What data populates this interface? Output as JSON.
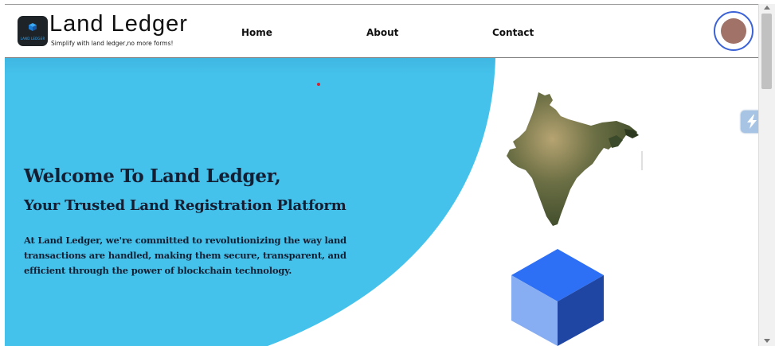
{
  "brand": {
    "title": "Land Ledger",
    "subtitle": "Simplify with land ledger,no more forms!",
    "logo_text": "LAND LEDGER"
  },
  "nav": {
    "home": "Home",
    "about": "About",
    "contact": "Contact"
  },
  "hero": {
    "welcome": "Welcome To Land Ledger,",
    "tagline": "Your Trusted Land Registration Platform",
    "description": "At Land Ledger, we're committed to revolutionizing the way land transactions are handled, making them secure, transparent, and efficient through the power of blockchain technology."
  },
  "colors": {
    "hero_blue": "#44c2eb",
    "avatar_ring": "#3b62d6",
    "avatar_fill": "#a07268",
    "cube_top": "#2d6ff5",
    "cube_left": "#87aef2",
    "cube_right": "#1f46a3"
  },
  "icons": {
    "float_button": "lightning-icon",
    "avatar": "user-avatar-icon"
  }
}
